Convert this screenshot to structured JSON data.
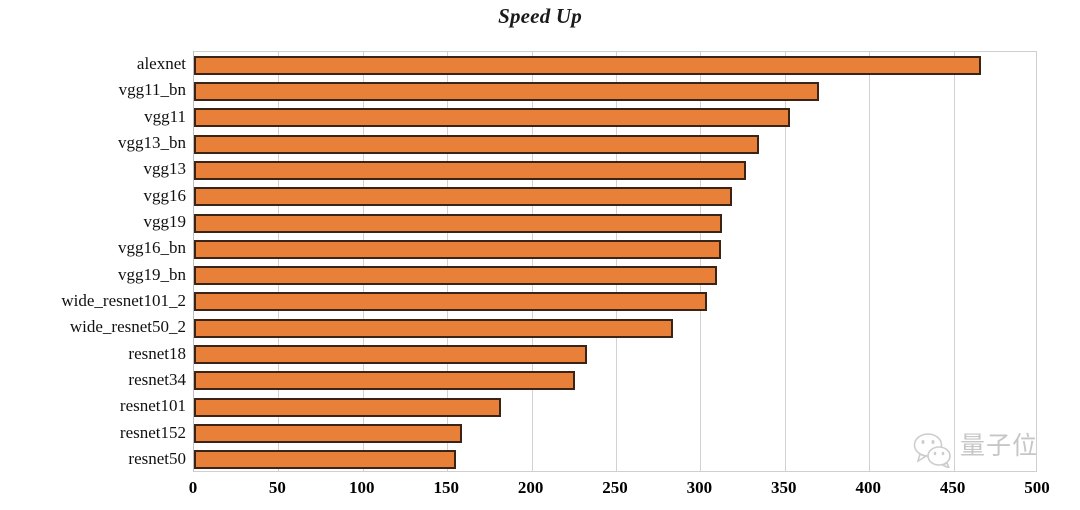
{
  "chart_data": {
    "type": "bar",
    "orientation": "horizontal",
    "title": "Speed Up",
    "xlabel": "",
    "ylabel": "",
    "xlim": [
      0,
      500
    ],
    "xticks": [
      0,
      50,
      100,
      150,
      200,
      250,
      300,
      350,
      400,
      450,
      500
    ],
    "xtick_labels": [
      "0",
      "50",
      "100",
      "150",
      "200",
      "250",
      "300",
      "350",
      "400",
      "450",
      "500"
    ],
    "grid": "vertical",
    "legend": "none",
    "bar_color": "#E8803A",
    "bar_edge_color": "#3B2316",
    "gridline_color": "#D2D2D2",
    "categories": [
      "alexnet",
      "vgg11_bn",
      "vgg11",
      "vgg13_bn",
      "vgg13",
      "vgg16",
      "vgg19",
      "vgg16_bn",
      "vgg19_bn",
      "wide_resnet101_2",
      "wide_resnet50_2",
      "resnet18",
      "resnet34",
      "resnet101",
      "resnet152",
      "resnet50"
    ],
    "values": [
      466,
      370,
      353,
      335,
      327,
      319,
      313,
      312,
      310,
      304,
      284,
      233,
      226,
      182,
      159,
      155
    ]
  },
  "watermark": {
    "text": "量子位",
    "icon": "wechat-icon"
  }
}
